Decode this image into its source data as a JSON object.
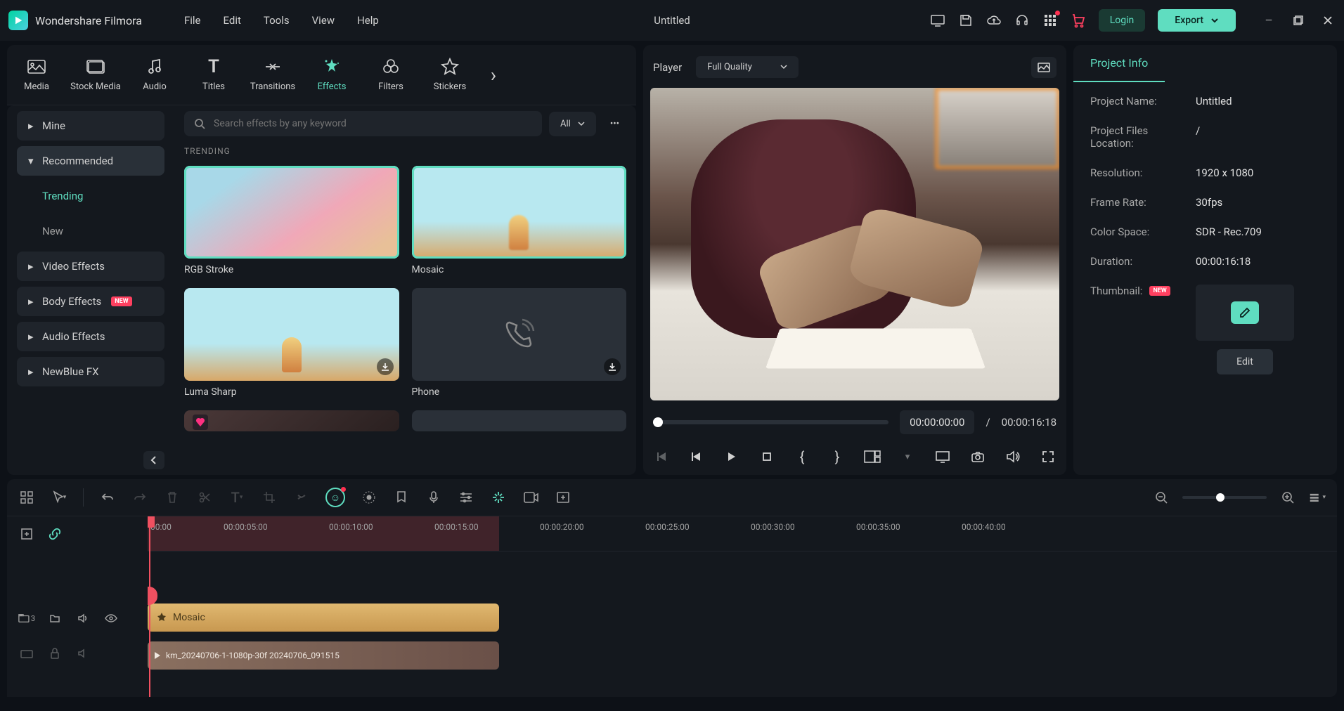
{
  "app": {
    "name": "Wondershare Filmora",
    "doc_title": "Untitled"
  },
  "menu": {
    "file": "File",
    "edit": "Edit",
    "tools": "Tools",
    "view": "View",
    "help": "Help"
  },
  "titlebar": {
    "login": "Login",
    "export": "Export"
  },
  "tabs": {
    "media": "Media",
    "stock_media": "Stock Media",
    "audio": "Audio",
    "titles": "Titles",
    "transitions": "Transitions",
    "effects": "Effects",
    "filters": "Filters",
    "stickers": "Stickers"
  },
  "sidebar": {
    "mine": "Mine",
    "recommended": "Recommended",
    "trending": "Trending",
    "new": "New",
    "video_effects": "Video Effects",
    "body_effects": "Body Effects",
    "audio_effects": "Audio Effects",
    "newblue": "NewBlue FX",
    "new_badge": "NEW"
  },
  "search": {
    "placeholder": "Search effects by any keyword",
    "filter": "All"
  },
  "effects": {
    "section": "TRENDING",
    "items": [
      {
        "name": "RGB Stroke"
      },
      {
        "name": "Mosaic"
      },
      {
        "name": "Luma Sharp"
      },
      {
        "name": "Phone"
      }
    ]
  },
  "player": {
    "label": "Player",
    "quality": "Full Quality",
    "current": "00:00:00:00",
    "sep": "/",
    "total": "00:00:16:18"
  },
  "project_info": {
    "tab": "Project Info",
    "name_label": "Project Name:",
    "name_value": "Untitled",
    "loc_label": "Project Files Location:",
    "loc_value": "/",
    "res_label": "Resolution:",
    "res_value": "1920 x 1080",
    "fps_label": "Frame Rate:",
    "fps_value": "30fps",
    "cs_label": "Color Space:",
    "cs_value": "SDR - Rec.709",
    "dur_label": "Duration:",
    "dur_value": "00:00:16:18",
    "thumb_label": "Thumbnail:",
    "thumb_badge": "NEW",
    "edit": "Edit"
  },
  "timeline": {
    "ticks": [
      "00:00",
      "00:00:05:00",
      "00:00:10:00",
      "00:00:15:00",
      "00:00:20:00",
      "00:00:25:00",
      "00:00:30:00",
      "00:00:35:00",
      "00:00:40:00"
    ],
    "track3": "3",
    "clip_mosaic": "Mosaic",
    "clip_video": "km_20240706-1-1080p-30f 20240706_091515"
  }
}
